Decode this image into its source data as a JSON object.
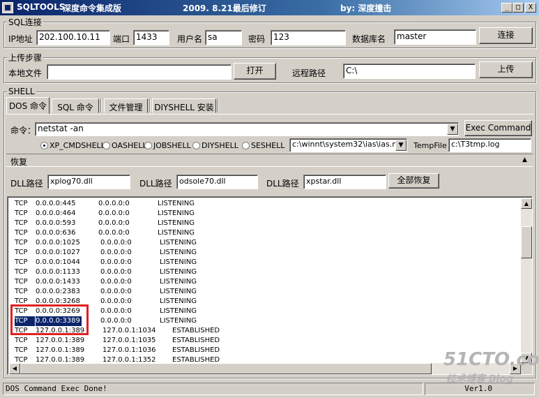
{
  "window": {
    "app_name": "SQLTOOLS",
    "title": "深度命令集成版",
    "date_text": "2009. 8.21最后修订",
    "author": "by: 深度撞击",
    "minimize": "_",
    "maximize": "□",
    "close": "X"
  },
  "sql_group": {
    "legend": "SQL连接",
    "ip_label": "IP地址",
    "ip_value": "202.100.10.11",
    "port_label": "端口",
    "port_value": "1433",
    "user_label": "用户名",
    "user_value": "sa",
    "pass_label": "密码",
    "pass_value": "123",
    "db_label": "数据库名",
    "db_value": "master",
    "connect_label": "连接"
  },
  "upload_group": {
    "legend": "上传步骤",
    "local_label": "本地文件",
    "local_value": "",
    "open_label": "打开",
    "remote_label": "远程路径",
    "remote_value": "C:\\",
    "upload_label": "上传"
  },
  "shell_group": {
    "legend": "SHELL",
    "tabs": [
      "DOS 命令",
      "SQL 命令",
      "文件管理",
      "DIYSHELL 安装"
    ],
    "command_label": "命令：",
    "command_value": "netstat -an",
    "exec_label": "Exec Command",
    "radios": [
      "XP_CMDSHELL",
      "OASHELL",
      "JOBSHELL",
      "DIYSHELL",
      "SESHELL"
    ],
    "mdb_value": "c:\\winnt\\system32\\ias\\ias.mdb",
    "tempfile_label": "TempFile",
    "tempfile_value": "c:\\T3tmp.log"
  },
  "restore": {
    "title": "恢复",
    "dll1_label": "DLL路径",
    "dll1_value": "xplog70.dll",
    "dll2_label": "DLL路径",
    "dll2_value": "odsole70.dll",
    "dll3_label": "DLL路径",
    "dll3_value": "xpstar.dll",
    "restore_all_label": "全部恢复"
  },
  "output_rows": [
    [
      "TCP",
      "0.0.0.0:445",
      "0.0.0.0:0",
      "LISTENING"
    ],
    [
      "TCP",
      "0.0.0.0:464",
      "0.0.0.0:0",
      "LISTENING"
    ],
    [
      "TCP",
      "0.0.0.0:593",
      "0.0.0.0:0",
      "LISTENING"
    ],
    [
      "TCP",
      "0.0.0.0:636",
      "0.0.0.0:0",
      "LISTENING"
    ],
    [
      "TCP",
      "0.0.0.0:1025",
      "0.0.0.0:0",
      "LISTENING"
    ],
    [
      "TCP",
      "0.0.0.0:1027",
      "0.0.0.0:0",
      "LISTENING"
    ],
    [
      "TCP",
      "0.0.0.0:1044",
      "0.0.0.0:0",
      "LISTENING"
    ],
    [
      "TCP",
      "0.0.0.0:1133",
      "0.0.0.0:0",
      "LISTENING"
    ],
    [
      "TCP",
      "0.0.0.0:1433",
      "0.0.0.0:0",
      "LISTENING"
    ],
    [
      "TCP",
      "0.0.0.0:2383",
      "0.0.0.0:0",
      "LISTENING"
    ],
    [
      "TCP",
      "0.0.0.0:3268",
      "0.0.0.0:0",
      "LISTENING"
    ],
    [
      "TCP",
      "0.0.0.0:3269",
      "0.0.0.0:0",
      "LISTENING"
    ],
    [
      "TCP",
      "0.0.0.0:3389",
      "0.0.0.0:0",
      "LISTENING"
    ],
    [
      "TCP",
      "127.0.0.1:389",
      "127.0.0.1:1034",
      "ESTABLISHED"
    ],
    [
      "TCP",
      "127.0.0.1:389",
      "127.0.0.1:1035",
      "ESTABLISHED"
    ],
    [
      "TCP",
      "127.0.0.1:389",
      "127.0.0.1:1036",
      "ESTABLISHED"
    ],
    [
      "TCP",
      "127.0.0.1:389",
      "127.0.0.1:1352",
      "ESTABLISHED"
    ]
  ],
  "status": {
    "message": "DOS Command Exec Done!",
    "version": "Ver1.0"
  },
  "watermark": {
    "site": "51CTO.com",
    "sub": "技术博客 Blog"
  },
  "colors": {
    "highlight_box": "#e02020",
    "selection": "#0a246a"
  }
}
